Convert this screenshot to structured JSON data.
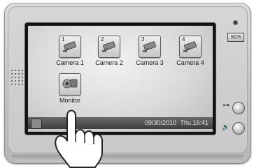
{
  "device": {
    "sos_label": "SOS"
  },
  "menu": {
    "tiles": [
      {
        "label": "Camera 1",
        "badge": "1"
      },
      {
        "label": "Camera 2",
        "badge": "2"
      },
      {
        "label": "Camera 3",
        "badge": "3"
      },
      {
        "label": "Camera 4",
        "badge": "4"
      },
      {
        "label": "Monitor"
      }
    ]
  },
  "status_bar": {
    "date": "09/30/2010",
    "time": "Thu.16:41"
  },
  "side_buttons": [
    {
      "icon": "key-icon"
    },
    {
      "icon": "talk-speaker-icon"
    }
  ]
}
